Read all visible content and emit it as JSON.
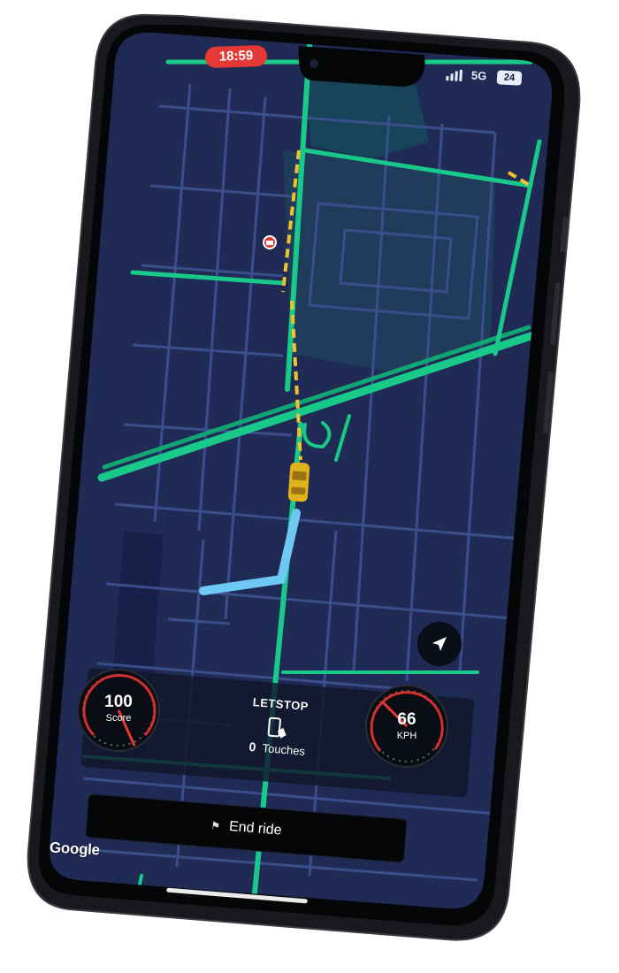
{
  "status_bar": {
    "time": "18:59",
    "network": "5G",
    "battery": "24"
  },
  "panel": {
    "app_title": "LETSTOP",
    "touches_count": "0",
    "touches_label": "Touches"
  },
  "score_gauge": {
    "value": "100",
    "unit": "Score"
  },
  "speed_gauge": {
    "value": "66",
    "unit": "KPH"
  },
  "end_ride": {
    "label": "End ride"
  },
  "map": {
    "attribution": "Google"
  },
  "colors": {
    "map_background": "#1f2a55",
    "traffic_green": "#19c98a",
    "traffic_yellow": "#f2c12e",
    "route": "#6ec8f5",
    "status_red": "#e53935"
  },
  "icons": {
    "locate": "navigation-arrow-icon",
    "poi": "cinema-icon",
    "phone": "phone-touch-icon",
    "flag": "checkered-flag-icon",
    "car": "car-marker-icon"
  }
}
